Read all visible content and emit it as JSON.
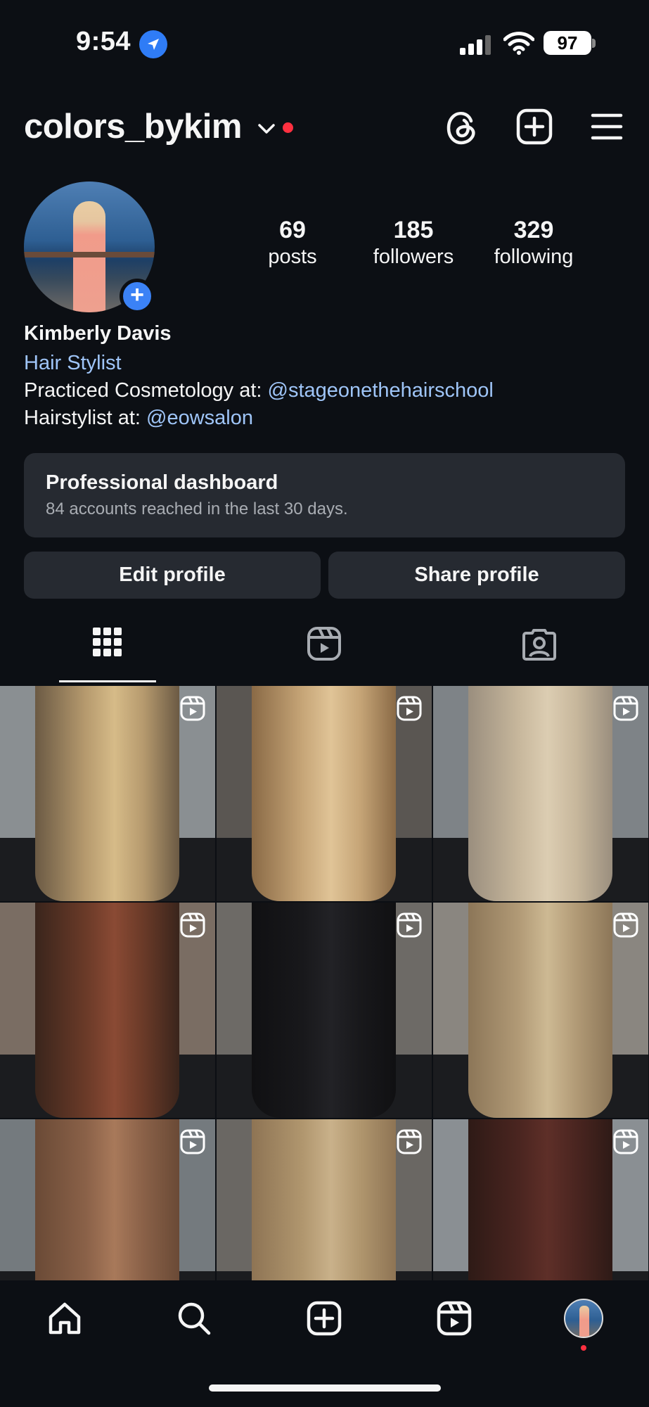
{
  "status_bar": {
    "time": "9:54",
    "battery": "97"
  },
  "header": {
    "username": "colors_bykim"
  },
  "profile": {
    "stats": [
      {
        "num": "69",
        "label": "posts"
      },
      {
        "num": "185",
        "label": "followers"
      },
      {
        "num": "329",
        "label": "following"
      }
    ],
    "name": "Kimberly Davis",
    "category": "Hair Stylist",
    "bio_line1_text": "Practiced Cosmetology at: ",
    "bio_line1_mention": "@stageonethehairschool",
    "bio_line2_text": "Hairstylist at: ",
    "bio_line2_mention": "@eowsalon"
  },
  "dashboard": {
    "title": "Professional dashboard",
    "subtitle": "84 accounts reached in the last 30 days."
  },
  "buttons": {
    "edit": "Edit profile",
    "share": "Share profile"
  },
  "tabs": [
    {
      "icon": "grid-icon",
      "active": true
    },
    {
      "icon": "reels-icon",
      "active": false
    },
    {
      "icon": "tagged-icon",
      "active": false
    }
  ],
  "posts": [
    {
      "hair": [
        "#6b5a44",
        "#b69a6e",
        "#d6bb88"
      ],
      "bg": "#8a8f92"
    },
    {
      "hair": [
        "#8a6a46",
        "#c6a577",
        "#e0c497"
      ],
      "bg": "#5a5652"
    },
    {
      "hair": [
        "#9a8e7e",
        "#c7b79c",
        "#dccdb2"
      ],
      "bg": "#7e8387"
    },
    {
      "hair": [
        "#3a251c",
        "#6a3a28",
        "#8a4a34"
      ],
      "bg": "#7a6d63"
    },
    {
      "hair": [
        "#101012",
        "#18181b",
        "#222226"
      ],
      "bg": "#6d6a66"
    },
    {
      "hair": [
        "#8c7658",
        "#b19a76",
        "#cdb993"
      ],
      "bg": "#8a8680"
    },
    {
      "hair": [
        "#6a4a36",
        "#8a6148",
        "#a8795a"
      ],
      "bg": "#747a7e"
    },
    {
      "hair": [
        "#8e7454",
        "#b0966e",
        "#c9b18a"
      ],
      "bg": "#6a6763"
    },
    {
      "hair": [
        "#2e1a16",
        "#4a2520",
        "#5e2f28"
      ],
      "bg": "#8a8f93"
    }
  ],
  "colors": {
    "background": "#0c0f14",
    "accent_link": "#9fc5f8",
    "button_bg": "#262a31",
    "notification": "#ff3040",
    "add_blue": "#3b82f6"
  }
}
